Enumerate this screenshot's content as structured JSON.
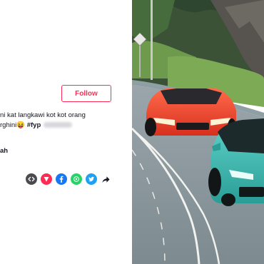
{
  "post": {
    "follow_label": "Follow",
    "caption_line1": "ni kat langkawi kot kot orang",
    "caption_line2_text": "rghini",
    "caption_emoji": "😝",
    "hashtag": "#fyp",
    "music_label": "ah"
  },
  "share": {
    "icons": [
      "embed-icon",
      "tiktok-send-icon",
      "facebook-icon",
      "whatsapp-icon",
      "twitter-icon",
      "share-arrow-icon"
    ]
  },
  "colors": {
    "follow_accent": "#fe2c55",
    "embed": "#4a4a4f",
    "send": "#fe2c55",
    "facebook": "#1877f2",
    "whatsapp": "#25d366",
    "twitter": "#1da1f2",
    "lambo_orange": "#ee3b2a",
    "lambo_teal": "#2fb5ad"
  }
}
